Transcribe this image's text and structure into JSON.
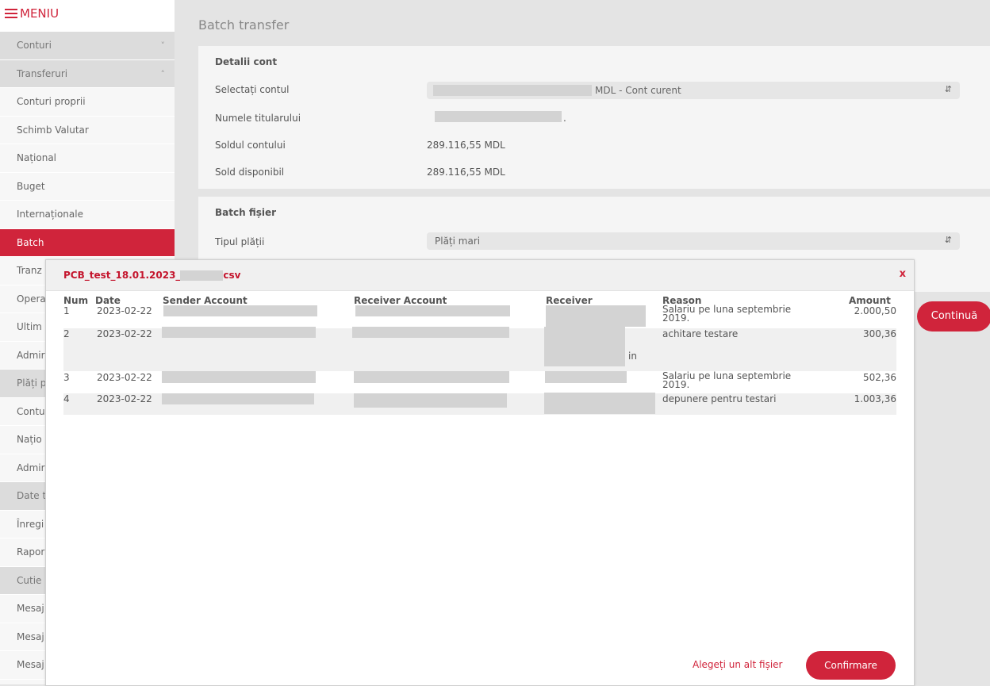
{
  "menu": {
    "label": "MENIU"
  },
  "sidebar": {
    "items": [
      {
        "label": "Conturi",
        "type": "group",
        "chevron": "v"
      },
      {
        "label": "Transferuri",
        "type": "group",
        "chevron": "^"
      },
      {
        "label": "Conturi proprii"
      },
      {
        "label": "Schimb Valutar"
      },
      {
        "label": "Național"
      },
      {
        "label": "Buget"
      },
      {
        "label": "Internaționale"
      },
      {
        "label": "Batch",
        "active": true
      },
      {
        "label": "Tranz"
      },
      {
        "label": "Opera"
      },
      {
        "label": "Ultim"
      },
      {
        "label": "Admir"
      },
      {
        "label": "Plăți p",
        "type": "group"
      },
      {
        "label": "Contu"
      },
      {
        "label": "Națio"
      },
      {
        "label": "Admir"
      },
      {
        "label": "Date t",
        "type": "group"
      },
      {
        "label": "Înregi"
      },
      {
        "label": "Rapor"
      },
      {
        "label": "Cutie",
        "type": "group"
      },
      {
        "label": "Mesaj"
      },
      {
        "label": "Mesaj"
      },
      {
        "label": "Mesaj"
      }
    ]
  },
  "page": {
    "title": "Batch transfer"
  },
  "account_details": {
    "heading": "Detalii cont",
    "select_label": "Selectați contul",
    "select_value": "MDL - Cont curent",
    "holder_label": "Numele titularului",
    "holder_suffix": ".",
    "balance_label": "Soldul contului",
    "balance_value": "289.116,55 MDL",
    "available_label": "Sold disponibil",
    "available_value": "289.116,55 MDL"
  },
  "batch_file": {
    "heading": "Batch fișier",
    "payment_type_label": "Tipul plății",
    "payment_type_value": "Plăți mari"
  },
  "continue_button": "Continuă",
  "modal": {
    "title_prefix": "PCB_test_18.01.2023_",
    "title_suffix": "csv",
    "close": "x",
    "headers": {
      "num": "Num",
      "date": "Date",
      "sender": "Sender Account",
      "receiver_account": "Receiver Account",
      "receiver": "Receiver",
      "reason": "Reason",
      "amount": "Amount"
    },
    "rows": [
      {
        "num": "1",
        "date": "2023-02-22",
        "reason": "Salariu pe luna septembrie 2019.",
        "amount": "2.000,50"
      },
      {
        "num": "2",
        "date": "2023-02-22",
        "reason": "achitare testare",
        "amount": "300,36",
        "receiver_fragment": "in"
      },
      {
        "num": "3",
        "date": "2023-02-22",
        "reason": "Salariu pe luna septembrie 2019.",
        "amount": "502,36"
      },
      {
        "num": "4",
        "date": "2023-02-22",
        "reason": "depunere pentru testari",
        "amount": "1.003,36"
      }
    ],
    "alt_file": "Alegeți un alt fișier",
    "confirm": "Confirmare"
  },
  "colors": {
    "accent": "#d0243b",
    "redacted": "#d3d3d3"
  }
}
